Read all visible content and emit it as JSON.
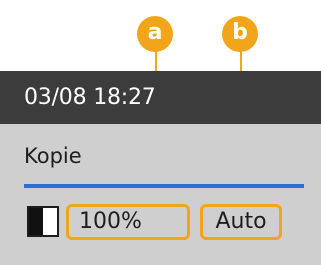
{
  "status_bar": {
    "datetime": "03/08 18:27"
  },
  "main": {
    "mode_label": "Kopie",
    "color_mode_icon": "black-white-half-square-icon",
    "zoom": "100%",
    "paper": "Auto"
  },
  "callouts": {
    "a": "a",
    "b": "b"
  },
  "colors": {
    "status_bg": "#3c3c3c",
    "panel_bg": "#cfcfcf",
    "divider": "#2b6fd6",
    "highlight": "#f2a51a"
  }
}
